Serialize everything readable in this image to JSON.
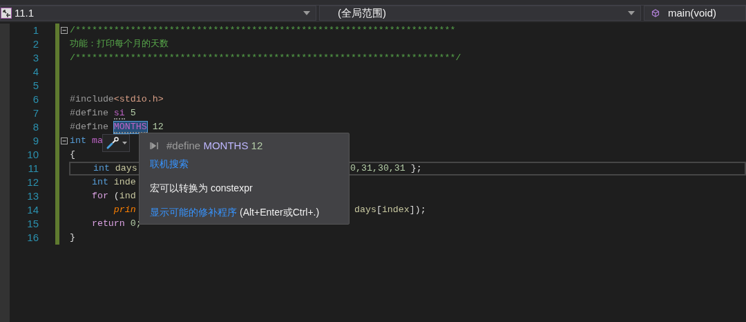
{
  "navigation_bar": {
    "project": "11.1",
    "scope": "(全局范围)",
    "member": "main(void)"
  },
  "editor": {
    "lines": [
      {
        "number": "1",
        "fold": true,
        "current": false,
        "tokens": [
          {
            "kind": "comment",
            "text": "/*********************************************************************"
          }
        ]
      },
      {
        "number": "2",
        "fold": false,
        "current": false,
        "tokens": [
          {
            "kind": "comment",
            "text": "功能：打印每个月的天数"
          }
        ]
      },
      {
        "number": "3",
        "fold": false,
        "current": false,
        "tokens": [
          {
            "kind": "comment",
            "text": "/*********************************************************************/"
          }
        ]
      },
      {
        "number": "4",
        "fold": false,
        "current": false
      },
      {
        "number": "5",
        "fold": false,
        "current": false
      },
      {
        "number": "6",
        "fold": false,
        "current": false,
        "tokens": [
          {
            "kind": "preproc",
            "text": "#include"
          },
          {
            "kind": "string",
            "text": "<stdio.h>"
          }
        ]
      },
      {
        "number": "7",
        "fold": false,
        "current": false,
        "tokens": [
          {
            "kind": "preproc",
            "text": "#define "
          },
          {
            "kind": "macro",
            "text": "si",
            "highlighted": false
          },
          {
            "kind": "number",
            "text": " 5"
          }
        ]
      },
      {
        "number": "8",
        "fold": false,
        "current": false,
        "tokens": [
          {
            "kind": "preproc",
            "text": "#define "
          },
          {
            "kind": "macro",
            "text": "MONTHS",
            "highlighted": true
          },
          {
            "kind": "number",
            "text": " 12"
          }
        ]
      },
      {
        "number": "9",
        "fold": true,
        "current": false,
        "tokens": [
          {
            "kind": "keyword",
            "text": "int"
          },
          {
            "kind": "function",
            "text": " ma"
          }
        ]
      },
      {
        "number": "10",
        "fold": false,
        "current": false,
        "tokens": [
          {
            "kind": "plain",
            "text": "{"
          }
        ]
      },
      {
        "number": "11",
        "fold": false,
        "current": true,
        "tokens": [
          {
            "kind": "keyword",
            "text": "    int"
          },
          {
            "kind": "variable",
            "text": " days"
          }
        ],
        "tail": [
          {
            "kind": "number",
            "text": "0,31,30,31"
          },
          {
            "kind": "plain",
            "text": " };"
          }
        ]
      },
      {
        "number": "12",
        "fold": false,
        "current": false,
        "tokens": [
          {
            "kind": "keyword",
            "text": "    int"
          },
          {
            "kind": "variable",
            "text": " inde"
          }
        ]
      },
      {
        "number": "13",
        "fold": false,
        "current": false,
        "tokens": [
          {
            "kind": "control",
            "text": "    for"
          },
          {
            "kind": "plain",
            "text": " ("
          },
          {
            "kind": "variable",
            "text": "ind"
          }
        ]
      },
      {
        "number": "14",
        "fold": false,
        "current": false,
        "tokens": [
          {
            "kind": "call",
            "text": "        prin"
          }
        ],
        "tail": [
          {
            "kind": "variable",
            "text": " days"
          },
          {
            "kind": "plain",
            "text": "["
          },
          {
            "kind": "variable",
            "text": "index"
          },
          {
            "kind": "plain",
            "text": "]);"
          }
        ]
      },
      {
        "number": "15",
        "fold": false,
        "current": false,
        "tokens": [
          {
            "kind": "control",
            "text": "    return"
          },
          {
            "kind": "number",
            "text": " 0;"
          }
        ]
      },
      {
        "number": "16",
        "fold": false,
        "current": false,
        "tokens": [
          {
            "kind": "plain",
            "text": "}"
          }
        ]
      }
    ]
  },
  "quick_info": {
    "signature": {
      "directive": "#define",
      "name": "MONTHS",
      "value": "12"
    },
    "search_link": "联机搜索",
    "message": "宏可以转换为 constexpr",
    "fix_link": "显示可能的修补程序",
    "shortcut": "(Alt+Enter或Ctrl+.)"
  }
}
